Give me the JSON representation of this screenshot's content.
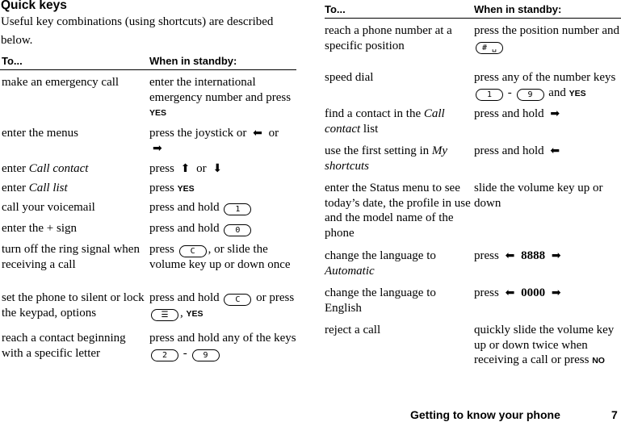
{
  "title": "Quick keys",
  "intro": "Useful key combinations (using shortcuts) are described below.",
  "table_headers": {
    "to": "To...",
    "when": "When in standby:"
  },
  "keywords": {
    "yes": "YES",
    "no": "NO"
  },
  "left_rows": [
    {
      "to": "make an emergency call",
      "when": [
        "enter the international emergency number and press ",
        {
          "kw": "yes"
        }
      ]
    },
    {
      "to": "enter the menus",
      "when": [
        "press the joystick or ",
        {
          "arrow": "left-arrow"
        },
        " or ",
        {
          "arrow": "right-arrow"
        }
      ]
    },
    {
      "to_parts": [
        "enter ",
        {
          "i": "Call contact"
        }
      ],
      "when": [
        "press ",
        {
          "arrow": "up-arrow"
        },
        " or ",
        {
          "arrow": "down-arrow"
        }
      ]
    },
    {
      "to_parts": [
        "enter ",
        {
          "i": "Call list"
        }
      ],
      "when": [
        "press ",
        {
          "kw": "yes"
        }
      ]
    },
    {
      "to": "call your voicemail",
      "when": [
        "press and hold ",
        {
          "key": "1"
        }
      ]
    },
    {
      "to": "enter the + sign",
      "when": [
        "press and hold ",
        {
          "key": "0"
        }
      ]
    },
    {
      "to": "turn off the ring signal when receiving a call",
      "when": [
        "press ",
        {
          "key": "C"
        },
        ", or slide the volume key up or down once"
      ]
    },
    {
      "to": "set the phone to silent or lock the keypad, options",
      "when": [
        "press and hold ",
        {
          "key": "C"
        },
        " or press ",
        {
          "key": "☰"
        },
        ", ",
        {
          "kw": "yes"
        }
      ]
    },
    {
      "to": "reach a contact beginning with a specific letter",
      "when": [
        "press and hold any of the keys ",
        {
          "key": "2"
        },
        " - ",
        {
          "key": "9"
        }
      ]
    }
  ],
  "right_rows": [
    {
      "to": "reach a phone number at a specific position",
      "when": [
        "press the position number and ",
        {
          "key": "# ␣"
        }
      ]
    },
    {
      "to": "speed dial",
      "when": [
        "press any of the number keys ",
        {
          "key": "1"
        },
        " - ",
        {
          "key": "9"
        },
        " and ",
        {
          "kw": "yes"
        }
      ]
    },
    {
      "to_parts": [
        "find a contact in the ",
        {
          "i": "Call contact"
        },
        " list"
      ],
      "when": [
        "press and hold ",
        {
          "arrow": "right-arrow"
        }
      ]
    },
    {
      "to_parts": [
        "use the first setting in ",
        {
          "i": "My shortcuts"
        }
      ],
      "when": [
        "press and hold ",
        {
          "arrow": "left-arrow"
        }
      ]
    },
    {
      "to": "enter the Status menu to see today’s date, the profile in use and the model name of the phone",
      "when": [
        "slide the volume key up or down"
      ]
    },
    {
      "to_parts": [
        "change the language to ",
        {
          "i": "Automatic"
        }
      ],
      "when": [
        "press ",
        {
          "arrow": "left-arrow"
        },
        {
          "b": " 8888 "
        },
        {
          "arrow": "right-arrow"
        }
      ]
    },
    {
      "to": "change the language to English",
      "when": [
        "press ",
        {
          "arrow": "left-arrow"
        },
        {
          "b": " 0000 "
        },
        {
          "arrow": "right-arrow"
        }
      ]
    },
    {
      "to": "reject a call",
      "when": [
        "quickly slide the volume key up or down twice when receiving a call or press ",
        {
          "kw": "no"
        }
      ]
    }
  ],
  "arrows": {
    "left-arrow": "⬅",
    "right-arrow": "➡",
    "up-arrow": "⬆",
    "down-arrow": "⬇"
  },
  "footer": {
    "section": "Getting to know your phone",
    "page": "7"
  }
}
